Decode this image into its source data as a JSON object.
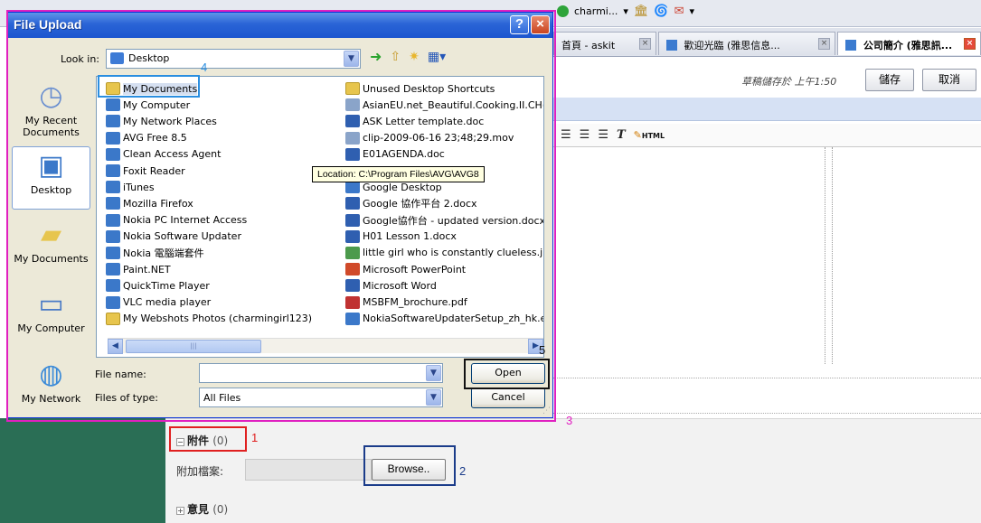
{
  "browser": {
    "toolbar": {
      "user_label": "charmi...",
      "dropdown_glyph": "▾"
    },
    "tabs": [
      {
        "label": "首頁 - askit",
        "close": "×"
      },
      {
        "label": "歡迎光臨 (雅思信息...",
        "close": "×"
      },
      {
        "label": "公司簡介 (雅思訊...",
        "close": "×"
      }
    ],
    "draft_note": "草稿儲存於 上午1:50",
    "save_button": "儲存",
    "cancel_button": "取消",
    "editor_toolbar": {
      "html_label": "HTML"
    }
  },
  "attachments": {
    "header": "附件",
    "count": "(0)",
    "field_label": "附加檔案:",
    "browse_button": "Browse.."
  },
  "comments": {
    "header": "意見",
    "count": "(0)"
  },
  "dialog": {
    "title": "File Upload",
    "help_glyph": "?",
    "close_glyph": "×",
    "look_in_label": "Look in:",
    "look_in_value": "Desktop",
    "places": [
      {
        "label": "My Recent Documents",
        "icon": "recent-documents-icon"
      },
      {
        "label": "Desktop",
        "icon": "desktop-icon"
      },
      {
        "label": "My Documents",
        "icon": "my-documents-icon"
      },
      {
        "label": "My Computer",
        "icon": "my-computer-icon"
      },
      {
        "label": "My Network",
        "icon": "my-network-icon"
      }
    ],
    "files_col1": [
      {
        "name": "My Documents",
        "kind": "folder"
      },
      {
        "name": "My Computer",
        "kind": "app"
      },
      {
        "name": "My Network Places",
        "kind": "app"
      },
      {
        "name": "AVG Free 8.5",
        "kind": "app"
      },
      {
        "name": "Clean Access Agent",
        "kind": "app"
      },
      {
        "name": "Foxit Reader",
        "kind": "app"
      },
      {
        "name": "iTunes",
        "kind": "app"
      },
      {
        "name": "Mozilla Firefox",
        "kind": "app"
      },
      {
        "name": "Nokia PC Internet Access",
        "kind": "app"
      },
      {
        "name": "Nokia Software Updater",
        "kind": "app"
      },
      {
        "name": "Nokia 電腦端套件",
        "kind": "app"
      },
      {
        "name": "Paint.NET",
        "kind": "app"
      },
      {
        "name": "QuickTime Player",
        "kind": "app"
      },
      {
        "name": "VLC media player",
        "kind": "app"
      },
      {
        "name": "My Webshots Photos (charmingirl123)",
        "kind": "folder"
      }
    ],
    "files_col2": [
      {
        "name": "Unused Desktop Shortcuts",
        "kind": "folder"
      },
      {
        "name": "AsianEU.net_Beautiful.Cooking.II.CH(",
        "kind": "media"
      },
      {
        "name": "ASK Letter template.doc",
        "kind": "doc"
      },
      {
        "name": "clip-2009-06-16 23;48;29.mov",
        "kind": "media"
      },
      {
        "name": "E01AGENDA.doc",
        "kind": "doc"
      },
      {
        "name": "",
        "kind": "none"
      },
      {
        "name": "Google Desktop",
        "kind": "app"
      },
      {
        "name": "Google 協作平台 2.docx",
        "kind": "doc"
      },
      {
        "name": "Google協作台 - updated version.docx",
        "kind": "doc"
      },
      {
        "name": "H01 Lesson 1.docx",
        "kind": "doc"
      },
      {
        "name": "little girl who is constantly clueless.jpg",
        "kind": "img"
      },
      {
        "name": "Microsoft PowerPoint",
        "kind": "ppt"
      },
      {
        "name": "Microsoft Word",
        "kind": "doc"
      },
      {
        "name": "MSBFM_brochure.pdf",
        "kind": "pdf"
      },
      {
        "name": "NokiaSoftwareUpdaterSetup_zh_hk.e",
        "kind": "app"
      }
    ],
    "tooltip": "Location: C:\\Program Files\\AVG\\AVG8",
    "file_name_label": "File name:",
    "file_name_value": "",
    "file_type_label": "Files of type:",
    "file_type_value": "All Files",
    "open_button": "Open",
    "cancel_button": "Cancel",
    "scroll_thumb_grip": "|||"
  },
  "annotations": [
    {
      "number": "1",
      "color": "#e02020"
    },
    {
      "number": "2",
      "color": "#1b3c8a"
    },
    {
      "number": "3",
      "color": "#e020c0"
    },
    {
      "number": "4",
      "color": "#2a8ee0"
    },
    {
      "number": "5",
      "color": "#111111"
    }
  ]
}
